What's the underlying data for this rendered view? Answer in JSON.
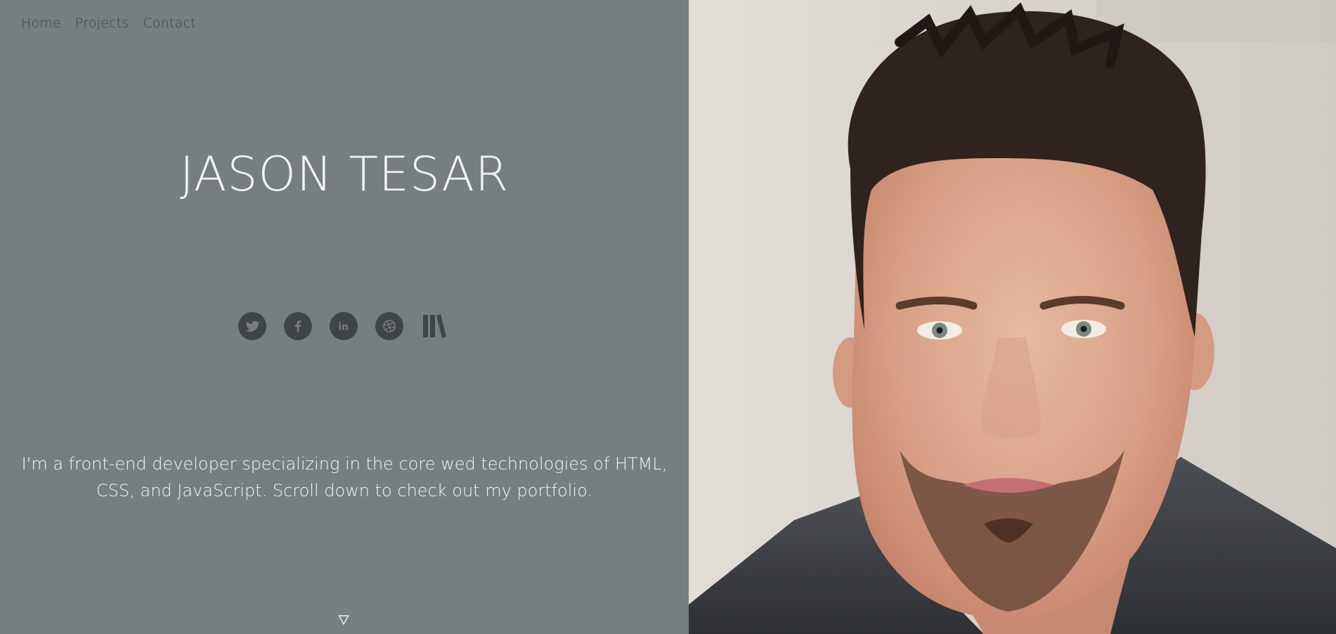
{
  "nav": {
    "items": [
      {
        "label": "Home"
      },
      {
        "label": "Projects"
      },
      {
        "label": "Contact"
      }
    ]
  },
  "hero": {
    "name": "JASON TESAR",
    "intro": "I'm a front-end developer specializing in the core wed technologies of HTML, CSS, and JavaScript. Scroll down to check out my portfolio."
  },
  "social": {
    "icons": [
      "twitter-icon",
      "facebook-icon",
      "linkedin-icon",
      "dribbble-icon",
      "library-icon"
    ]
  },
  "colors": {
    "panel_bg": "#767e81",
    "nav_text": "#3d4244",
    "icon_bg": "#3f4446",
    "title_text": "#f3f3f3"
  }
}
